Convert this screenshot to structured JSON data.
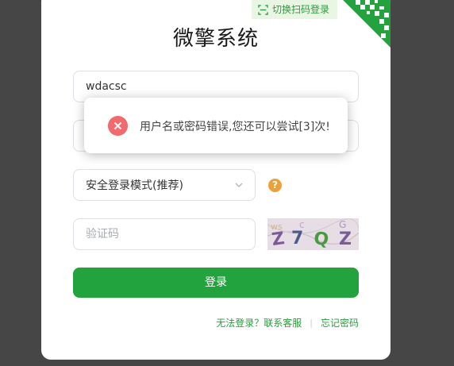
{
  "qr_login": {
    "label": "切换扫码登录",
    "icon": "scan-icon"
  },
  "title": "微擎系统",
  "username": {
    "value": "wdacsc",
    "placeholder": ""
  },
  "password": {
    "value": "",
    "placeholder": ""
  },
  "mode_select": {
    "selected": "安全登录模式(推荐)",
    "icon": "chevron-down-icon"
  },
  "help": {
    "glyph": "?",
    "icon": "question-icon"
  },
  "captcha": {
    "placeholder": "验证码",
    "image_text": "Z7QZ"
  },
  "login_button": {
    "label": "登录"
  },
  "links": {
    "cannot_login": "无法登录？联系客服",
    "separator": "|",
    "forgot_password": "忘记密码"
  },
  "toast": {
    "message": "用户名或密码错误,您还可以尝试[3]次!",
    "icon": "error-icon"
  },
  "colors": {
    "accent": "#22a33d",
    "link": "#2c9b3e",
    "error": "#f16a6e",
    "warning": "#e9a23b",
    "backdrop": "#464646"
  }
}
